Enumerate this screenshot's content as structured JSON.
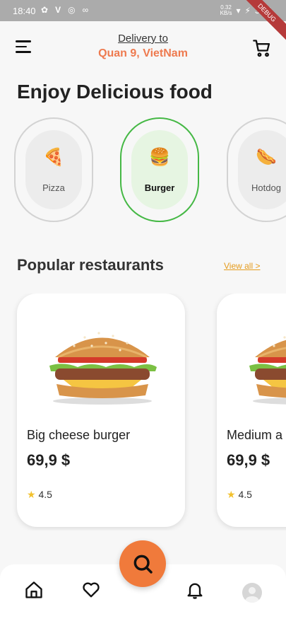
{
  "status_bar": {
    "time": "18:40",
    "left_icons": [
      "leaf-icon",
      "v-icon",
      "sync-icon",
      "glasses-icon"
    ],
    "network_speed": "0.32\nKB/s",
    "battery": "39%",
    "debug_banner": "DEBUG"
  },
  "header": {
    "delivery_label": "Delivery to",
    "delivery_location": "Quan 9, VietNam"
  },
  "main": {
    "title": "Enjoy Delicious food",
    "categories": [
      {
        "label": "Pizza",
        "icon": "pizza-icon",
        "emoji": "🍕",
        "selected": false
      },
      {
        "label": "Burger",
        "icon": "burger-icon",
        "emoji": "🍔",
        "selected": true
      },
      {
        "label": "Hotdog",
        "icon": "hotdog-icon",
        "emoji": "🌭",
        "selected": false
      }
    ],
    "popular": {
      "title": "Popular restaurants",
      "view_all": "View all >"
    },
    "restaurants": [
      {
        "name": "Big cheese burger",
        "price": "69,9 $",
        "rating": "4.5"
      },
      {
        "name": "Medium a",
        "price": "69,9 $",
        "rating": "4.5"
      }
    ]
  },
  "colors": {
    "accent": "#ee7a4f",
    "fab": "#f07a3b",
    "selected_border": "#45b845",
    "link": "#e59b1c"
  },
  "bottom_nav": [
    "home-icon",
    "heart-icon",
    "search-icon",
    "bell-icon",
    "avatar"
  ]
}
